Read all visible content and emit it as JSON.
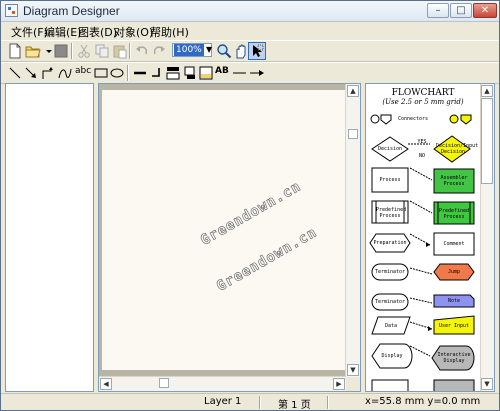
{
  "window": {
    "title": "Diagram Designer"
  },
  "menu": [
    "文件(F)",
    "编辑(E)",
    "图表(D)",
    "对象(O)",
    "帮助(H)"
  ],
  "toolbar": {
    "zoom_value": "100%",
    "text_tool_label": "abc",
    "ab_tool_label": "AB"
  },
  "canvas": {
    "watermark_lines": [
      "Greendown.cn",
      "Greendown.cn"
    ]
  },
  "palette": {
    "title": "FLOWCHART",
    "subtitle": "(Use 2.5 or 5 mm grid)",
    "connectors_label": "Connectors",
    "yes_label": "YES",
    "no_label": "NO",
    "shapes": {
      "decision": "Decision",
      "decision_input": "Decision/Input Decision",
      "process": "Process",
      "assembler_process": "Assembler Process",
      "predefined_process": "Predefined Process",
      "predefined_process_green": "Predefined Process",
      "preparation": "Preparation",
      "comment": "Comment",
      "terminator1": "Terminator",
      "jump": "Jump",
      "terminator2": "Terminator",
      "note": "Note",
      "data": "Data",
      "user_input": "User Input",
      "display": "Display",
      "interactive_display": "Interactive Display"
    },
    "colors": {
      "assembler": "#44c447",
      "predefined_green": "#3fc83f",
      "jump": "#f07a4a",
      "note": "#8c94ef",
      "user_input": "#f5f50a",
      "decision_input": "#f4f40e",
      "interactive": "#b8b8b8",
      "connector_yellow": "#f5f50a"
    }
  },
  "status": {
    "layer": "Layer 1",
    "page": "第 1 页",
    "coords": "x=55.8 mm  y=0.0 mm"
  }
}
